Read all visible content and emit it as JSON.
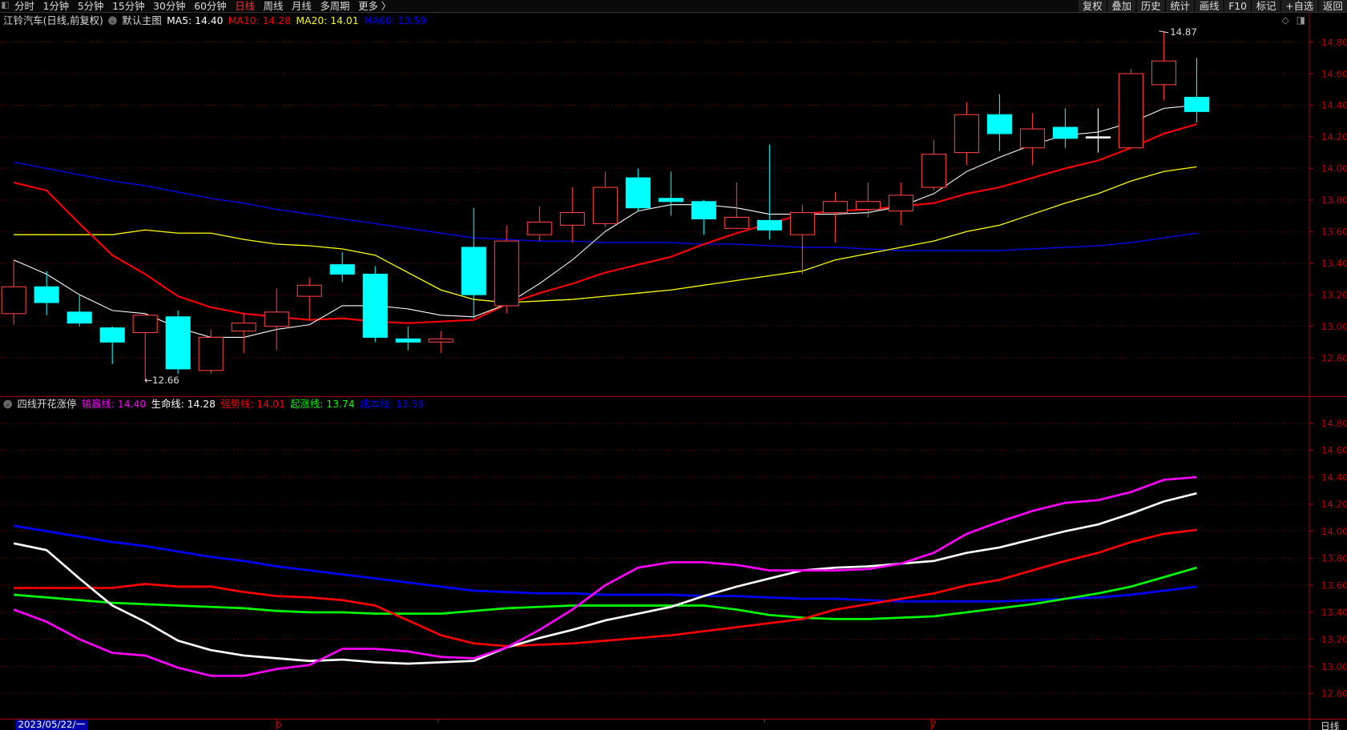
{
  "toolbar": {
    "periods": [
      "分时",
      "1分钟",
      "5分钟",
      "15分钟",
      "30分钟",
      "60分钟",
      "日线",
      "周线",
      "月线",
      "多周期",
      "更多 〉"
    ],
    "active_period": "日线",
    "actions": [
      "复权",
      "叠加",
      "历史",
      "统计",
      "画线",
      "F10",
      "标记",
      "+自选",
      "返回"
    ]
  },
  "main_legend": {
    "title": "江铃汽车(日线,前复权)",
    "template": "默认主图",
    "ma5": "MA5: 14.40",
    "ma10": "MA10: 14.28",
    "ma20": "MA20: 14.01",
    "ma60": "MA60: 13.59"
  },
  "sub_legend": {
    "title": "四线开花涨停",
    "l1": "输赢线: 14.40",
    "l2": "生命线: 14.28",
    "l3": "强势线: 14.01",
    "l4": "起涨线: 13.74",
    "l5": "成本线: 13.59"
  },
  "colors": {
    "up": "#ff4040",
    "down": "#00ffff",
    "ma5": "#ffffff",
    "ma10": "#ff0000",
    "ma20": "#ffff00",
    "ma60": "#0000ff",
    "magenta": "#ff00ff",
    "green": "#00ff00",
    "grid": "#800000"
  },
  "axis": {
    "ticks": [
      "14.80",
      "14.60",
      "14.40",
      "14.20",
      "14.00",
      "13.80",
      "13.60",
      "13.40",
      "13.20",
      "13.00",
      "12.80"
    ],
    "date": "2023/05/22/一",
    "month_labels": [
      "6",
      "7"
    ],
    "period_label": "日线"
  },
  "annotations": {
    "low": "←12.66",
    "high": "14.87"
  },
  "chart_data": {
    "type": "candlestick",
    "ylim": [
      12.8,
      14.8
    ],
    "candles": [
      [
        13.08,
        13.42,
        13.01,
        13.25
      ],
      [
        13.25,
        13.35,
        13.07,
        13.15
      ],
      [
        13.09,
        13.2,
        13.0,
        13.02
      ],
      [
        12.99,
        13.0,
        12.76,
        12.9
      ],
      [
        12.96,
        13.08,
        12.66,
        13.07
      ],
      [
        13.06,
        13.1,
        12.7,
        12.73
      ],
      [
        12.72,
        12.98,
        12.7,
        12.93
      ],
      [
        12.97,
        13.08,
        12.83,
        13.02
      ],
      [
        13.0,
        13.24,
        12.85,
        13.09
      ],
      [
        13.19,
        13.31,
        13.04,
        13.26
      ],
      [
        13.39,
        13.47,
        13.28,
        13.33
      ],
      [
        13.33,
        13.38,
        12.9,
        12.93
      ],
      [
        12.92,
        13.0,
        12.85,
        12.9
      ],
      [
        12.9,
        12.97,
        12.83,
        12.92
      ],
      [
        13.5,
        13.75,
        13.05,
        13.2
      ],
      [
        13.13,
        13.64,
        13.08,
        13.54
      ],
      [
        13.58,
        13.76,
        13.54,
        13.66
      ],
      [
        13.64,
        13.88,
        13.53,
        13.72
      ],
      [
        13.65,
        13.98,
        13.63,
        13.88
      ],
      [
        13.94,
        14.0,
        13.73,
        13.75
      ],
      [
        13.81,
        13.98,
        13.7,
        13.79
      ],
      [
        13.79,
        13.8,
        13.58,
        13.68
      ],
      [
        13.62,
        13.91,
        13.62,
        13.69
      ],
      [
        13.67,
        14.15,
        13.55,
        13.61
      ],
      [
        13.58,
        13.77,
        13.33,
        13.72
      ],
      [
        13.72,
        13.85,
        13.53,
        13.79
      ],
      [
        13.74,
        13.91,
        13.69,
        13.79
      ],
      [
        13.73,
        13.91,
        13.64,
        13.83
      ],
      [
        13.88,
        14.18,
        13.86,
        14.09
      ],
      [
        14.1,
        14.42,
        14.02,
        14.34
      ],
      [
        14.34,
        14.47,
        14.11,
        14.22
      ],
      [
        14.13,
        14.35,
        14.02,
        14.25
      ],
      [
        14.26,
        14.38,
        14.13,
        14.19
      ],
      [
        14.2,
        14.38,
        14.1,
        14.2
      ],
      [
        14.13,
        14.63,
        14.13,
        14.6
      ],
      [
        14.53,
        14.87,
        14.43,
        14.68
      ],
      [
        14.45,
        14.7,
        14.29,
        14.36
      ]
    ],
    "ma5": [
      13.42,
      13.33,
      13.2,
      13.1,
      13.08,
      12.99,
      12.93,
      12.93,
      12.98,
      13.01,
      13.13,
      13.13,
      13.11,
      13.07,
      13.06,
      13.14,
      13.27,
      13.42,
      13.6,
      13.73,
      13.77,
      13.77,
      13.75,
      13.71,
      13.71,
      13.71,
      13.72,
      13.76,
      13.84,
      13.98,
      14.07,
      14.15,
      14.21,
      14.23,
      14.29,
      14.38,
      14.4
    ],
    "ma10": [
      13.91,
      13.86,
      13.65,
      13.45,
      13.33,
      13.19,
      13.12,
      13.08,
      13.06,
      13.04,
      13.05,
      13.03,
      13.02,
      13.03,
      13.04,
      13.14,
      13.21,
      13.27,
      13.34,
      13.39,
      13.44,
      13.52,
      13.59,
      13.65,
      13.71,
      13.73,
      13.74,
      13.76,
      13.78,
      13.84,
      13.88,
      13.94,
      14.0,
      14.05,
      14.13,
      14.22,
      14.28
    ],
    "ma20": [
      13.58,
      13.58,
      13.58,
      13.58,
      13.61,
      13.59,
      13.59,
      13.55,
      13.52,
      13.51,
      13.49,
      13.45,
      13.34,
      13.23,
      13.17,
      13.15,
      13.16,
      13.17,
      13.19,
      13.21,
      13.23,
      13.26,
      13.29,
      13.32,
      13.35,
      13.42,
      13.46,
      13.5,
      13.54,
      13.6,
      13.64,
      13.71,
      13.78,
      13.84,
      13.92,
      13.98,
      14.01
    ],
    "ma60": [
      14.04,
      14.0,
      13.96,
      13.92,
      13.89,
      13.85,
      13.81,
      13.78,
      13.74,
      13.71,
      13.68,
      13.65,
      13.62,
      13.59,
      13.56,
      13.55,
      13.54,
      13.54,
      13.53,
      13.53,
      13.53,
      13.52,
      13.52,
      13.51,
      13.5,
      13.5,
      13.49,
      13.48,
      13.48,
      13.48,
      13.48,
      13.49,
      13.5,
      13.51,
      13.53,
      13.56,
      13.59
    ],
    "qizhang": [
      13.53,
      13.51,
      13.49,
      13.47,
      13.46,
      13.45,
      13.44,
      13.43,
      13.41,
      13.4,
      13.4,
      13.39,
      13.39,
      13.39,
      13.41,
      13.43,
      13.44,
      13.45,
      13.45,
      13.45,
      13.45,
      13.45,
      13.42,
      13.38,
      13.36,
      13.35,
      13.35,
      13.36,
      13.37,
      13.4,
      13.43,
      13.46,
      13.5,
      13.54,
      13.59,
      13.66,
      13.73
    ]
  }
}
